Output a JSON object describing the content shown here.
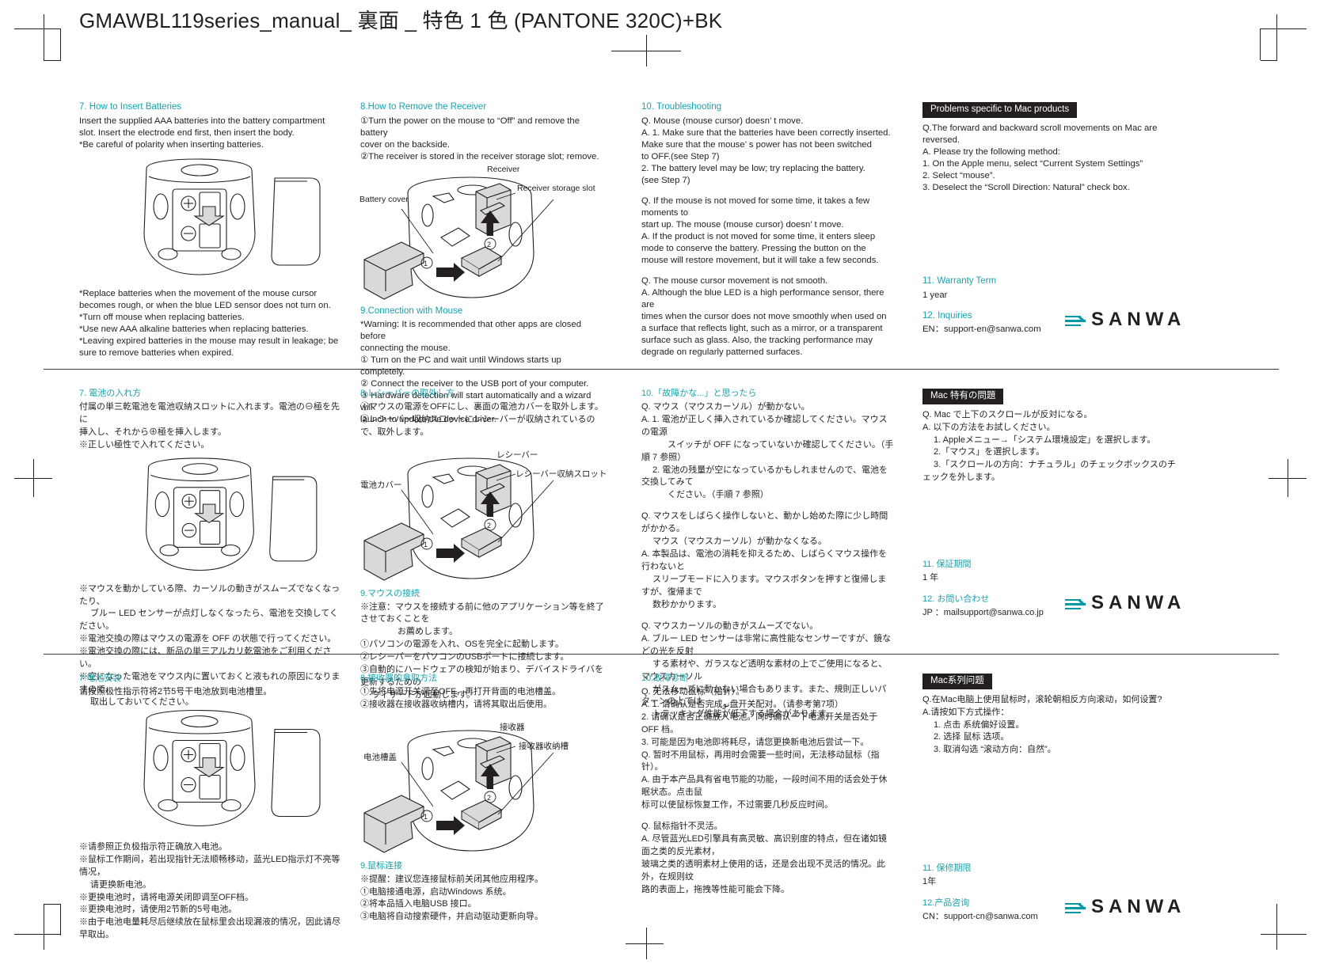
{
  "document": {
    "title": "GMAWBL119series_manual_ 裏面 _ 特色 1 色 (PANTONE 320C)+BK",
    "accent_color": "#19a2ad",
    "logo_color": "#0098a6",
    "text_color": "#231f20"
  },
  "logo": {
    "wordmark": "SANWA",
    "glyph_name": "sanwa-arrow-lines"
  },
  "en": {
    "batteries": {
      "heading": "7. How to Insert Batteries",
      "body": [
        "Insert the supplied AAA batteries into the battery compartment",
        "slot. Insert the electrode end first, then insert the body.",
        "*Be careful of polarity when inserting batteries."
      ],
      "notes": [
        "*Replace batteries when the movement of the mouse cursor",
        "  becomes rough, or when the blue LED sensor does not turn on.",
        "*Turn off mouse when replacing batteries.",
        "*Use new AAA alkaline batteries when replacing batteries.",
        "*Leaving expired batteries in the mouse may result in leakage; be",
        "  sure to remove batteries when expired."
      ]
    },
    "receiver": {
      "heading": "8.How to Remove the Receiver",
      "body": [
        "①Turn the power on the mouse to “Off” and remove the battery",
        "    cover on the backside.",
        "②The receiver is stored in the receiver storage slot; remove."
      ],
      "labels": {
        "receiver": "Receiver",
        "storage_slot": "Receiver storage slot",
        "battery_cover": "Battery cover",
        "step1": "①",
        "step2": "②"
      }
    },
    "connection": {
      "heading": "9.Connection with Mouse",
      "body": [
        "*Warning: It is recommended that other apps are closed before",
        "                 connecting the mouse.",
        "① Turn on the PC and wait until Windows starts up completely.",
        "② Connect the receiver to the USB port of your computer.",
        "③ Hardware detection will start automatically and a wizard will",
        "    launch to update the device driver."
      ]
    },
    "troubleshooting": {
      "heading": "10. Troubleshooting",
      "blocks": [
        [
          "Q. Mouse (mouse cursor) doesn’ t move.",
          "A. 1. Make sure that the batteries have been correctly inserted.",
          "        Make sure that the mouse’ s power has not been switched",
          "        to OFF.(see Step 7)",
          "    2. The battery level may be low; try replacing the battery.",
          "        (see Step 7)"
        ],
        [
          "Q. If the mouse is not moved for some time, it takes a few",
          "     moments to",
          "     start up. The mouse (mouse cursor) doesn’ t move.",
          "A. If the product is not moved for some time, it enters sleep",
          "     mode to conserve the battery. Pressing the button on the",
          "     mouse will restore movement, but it will take a few seconds."
        ],
        [
          "Q. The mouse cursor movement is not smooth.",
          "A. Although the blue LED is a high performance sensor, there are",
          "     times when the cursor does not move smoothly when used on",
          "     a surface that reflects light, such as a mirror, or a transparent",
          "     surface such as glass. Also, the tracking performance may",
          "     degrade on regularly patterned surfaces."
        ]
      ]
    },
    "mac": {
      "badge": "Problems specific to Mac products",
      "body": [
        "Q.The forward and backward scroll movements on Mac are",
        "        reversed.",
        "A. Please try the following method:",
        "    1. On the Apple menu, select “Current System Settings”",
        "    2. Select “mouse”.",
        "    3. Deselect the “Scroll Direction: Natural” check box."
      ]
    },
    "warranty": {
      "heading": "11. Warranty Term",
      "value": "1 year"
    },
    "inquiries": {
      "heading": "12. Inquiries",
      "value": "EN：support-en@sanwa.com"
    }
  },
  "jp": {
    "batteries": {
      "heading": "7. 電池の入れ方",
      "body": [
        "付属の単三乾電池を電池収納スロットに入れます。電池の⊖極を先に",
        "挿入し、それから⊕極を挿入します。",
        "※正しい極性で入れてください。"
      ],
      "notes": [
        "※マウスを動かしている際、カーソルの動きがスムーズでなくなったり、",
        "　 ブルー LED センサーが点灯しなくなったら、電池を交換してください。",
        "※電池交換の際はマウスの電源を OFF の状態で行ってください。",
        "※電池交換の際には、新品の単三アルカリ乾電池をご利用ください。",
        "※空になった電池をマウス内に置いておくと液もれの原因になりますので、",
        "　 取出しておいてください。"
      ]
    },
    "receiver": {
      "heading": "8.レシーバーの取外し方",
      "body": [
        "①マウスの電源をOFFにし、裏面の電池カバーを取外します。",
        "②レシーバー収納スロットにレシーバーが収納されているので、取外します。"
      ],
      "labels": {
        "receiver": "レシーバー",
        "storage_slot": "レシーバー収納スロット",
        "battery_cover": "電池カバー",
        "step1": "①",
        "step2": "②"
      }
    },
    "connection": {
      "heading": "9.マウスの接続",
      "body": [
        "※注意：マウスを接続する前に他のアプリケーション等を終了させておくことを",
        "　　　　 お薦めします。",
        "①パソコンの電源を入れ、OSを完全に起動します。",
        "②レシーバーをパソコンのUSBポートに接続します。",
        "③自動的にハードウェアの検知が始まり、デバイスドライバを更新するための",
        "　 ウィザードが起動します。"
      ]
    },
    "troubleshooting": {
      "heading": "10.「故障かな...」と思ったら",
      "blocks": [
        [
          "Q. マウス（マウスカーソル）が動かない。",
          "A. 1. 電池が正しく挿入されているか確認してください。マウスの電源",
          "　　　スイッチが OFF になっていないか確認してください。（手順 7 参照）",
          "　 2. 電池の残量が空になっているかもしれませんので、電池を交換してみて",
          "　　　ください。（手順 7 参照）"
        ],
        [
          "Q. マウスをしばらく操作しないと、動かし始めた際に少し時間がかかる。",
          "　 マウス（マウスカーソル）が動かなくなる。",
          "A. 本製品は、電池の消耗を抑えるため、しばらくマウス操作を行わないと",
          "　 スリープモードに入ります。マウスボタンを押すと復帰しますが、復帰まで",
          "　 数秒かかります。"
        ],
        [
          "Q. マウスカーソルの動きがスムーズでない。",
          "A. ブルー LED センサーは非常に高性能なセンサーですが、鏡などの光を反射",
          "　 する素材や、ガラスなど透明な素材の上でご使用になると、マウスカーソル",
          "　 がスムーズに動かない場合もあります。また、規則正しいパターンの上では",
          "　 トラッキング性能が低下する場合があります。"
        ]
      ]
    },
    "mac": {
      "badge": "Mac 特有の問題",
      "body": [
        "Q. Mac で上下のスクロールが反対になる。",
        "A. 以下の方法をお試しください。",
        "　 1. Appleメニュー→「システム環境設定」を選択します。",
        "　 2.「マウス」を選択します。",
        "　 3.「スクロールの方向：ナチュラル」のチェックボックスのチェックを外します。"
      ]
    },
    "warranty": {
      "heading": "11. 保証期間",
      "value": "1 年"
    },
    "inquiries": {
      "heading": "12. お問い合わせ",
      "value": "JP ：mailsupport@sanwa.co.jp"
    }
  },
  "cn": {
    "batteries": {
      "heading": "7.电池安装",
      "body": [
        "请按照极性指示符将2节5号干电池放到电池槽里。"
      ],
      "notes": [
        "※请参照正负极指示符正确放入电池。",
        "※鼠标工作期间，若出现指针无法顺畅移动，蓝光LED指示灯不亮等情况，",
        "　 请更换新电池。",
        "※更换电池时，请将电源关闭即调至OFF档。",
        "※更换电池时，请使用2节新的5号电池。",
        "※由于电池电量耗尽后继续放在鼠标里会出现漏液的情况，因此请尽早取出。"
      ]
    },
    "receiver": {
      "heading": "8.接收器的拿取方法",
      "body": [
        "①先将电源开关调至OFF，再打开背面的电池槽盖。",
        "②接收器在接收器收纳槽内，请将其取出后使用。"
      ],
      "labels": {
        "receiver": "接收器",
        "storage_slot": "接收器收纳槽",
        "battery_cover": "电池槽盖",
        "step1": "①",
        "step2": "②"
      }
    },
    "connection": {
      "heading": "9.鼠标连接",
      "body": [
        "※提醒：建议您连接鼠标前关闭其他应用程序。",
        "①电脑接通电源，启动Windows 系统。",
        "②将本品插入电脑USB 接口。",
        "③电脑将自动搜索硬件，并启动驱动更新向导。"
      ]
    },
    "troubleshooting": {
      "heading": "10.故障诊断",
      "blocks": [
        [
          "Q. 无法移动鼠标（指针）。",
          "A. 1. 请确认是否完成نو盘开关配对。（请参考第7项）",
          "    2. 请确认是否正确放入电池。同时确认一下电源开关是否处于 OFF 档。",
          "    3. 可能是因为电池即将耗尽，请您更换新电池后尝试一下。",
          "Q. 暂时不用鼠标，再用时会需要一些时间，无法移动鼠标（指针）。",
          "A. 由于本产品具有省电节能的功能，一段时间不用的话会处于休眠状态。点击鼠",
          "    标可以使鼠标恢复工作，不过需要几秒反应时间。"
        ],
        [
          "Q. 鼠标指针不灵活。",
          "A. 尽管蓝光LED引擎具有高灵敏、高识别度的特点，但在诸如镜面之类的反光素材，",
          "    玻璃之类的透明素材上使用的话，还是会出现不灵活的情况。此外，在规则纹",
          "    路的表面上，拖拽等性能可能会下降。"
        ]
      ]
    },
    "mac": {
      "badge": "Mac系列问题",
      "body": [
        "Q.在Mac电脑上使用鼠标时，滚轮朝相反方向滚动，如何设置?",
        "A.请按如下方式操作：",
        "　 1. 点击 系统偏好设置。",
        "　 2. 选择 鼠标 选项。",
        "　 3. 取消勾选 “滚动方向：自然”。"
      ]
    },
    "warranty": {
      "heading": "11. 保修期限",
      "value": "1年"
    },
    "inquiries": {
      "heading": "12.产品咨询",
      "value": "CN：support-cn@sanwa.com"
    }
  }
}
